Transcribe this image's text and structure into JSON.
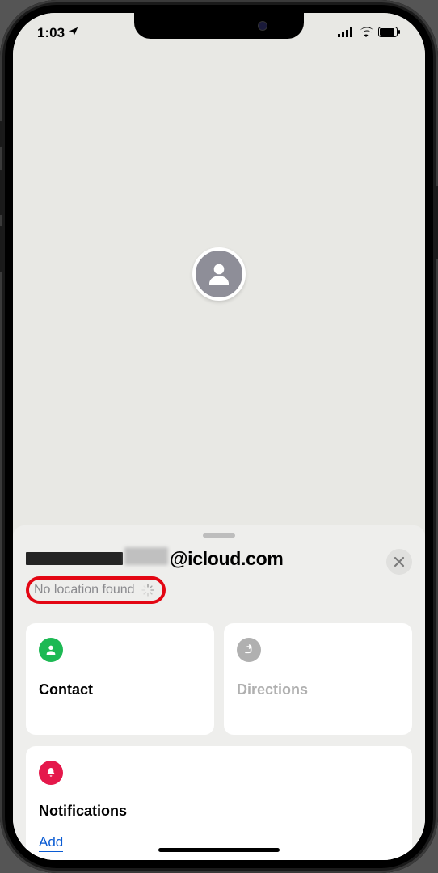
{
  "statusBar": {
    "time": "1:03"
  },
  "person": {
    "emailSuffix": "@icloud.com",
    "statusText": "No location found"
  },
  "cards": {
    "contactLabel": "Contact",
    "directionsLabel": "Directions"
  },
  "notifications": {
    "title": "Notifications",
    "addLabel": "Add"
  }
}
